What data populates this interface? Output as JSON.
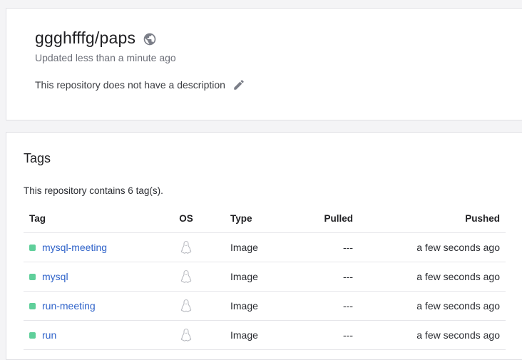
{
  "repo": {
    "name": "ggghfffg/paps",
    "updated": "Updated less than a minute ago",
    "description": "This repository does not have a description",
    "visibility_icon": "globe-icon",
    "edit_icon": "pencil-icon"
  },
  "tags": {
    "heading": "Tags",
    "count_text": "This repository contains 6 tag(s).",
    "columns": {
      "tag": "Tag",
      "os": "OS",
      "type": "Type",
      "pulled": "Pulled",
      "pushed": "Pushed"
    },
    "rows": [
      {
        "name": "mysql-meeting",
        "os_icon": "linux-icon",
        "type": "Image",
        "pulled": "---",
        "pushed": "a few seconds ago"
      },
      {
        "name": "mysql",
        "os_icon": "linux-icon",
        "type": "Image",
        "pulled": "---",
        "pushed": "a few seconds ago"
      },
      {
        "name": "run-meeting",
        "os_icon": "linux-icon",
        "type": "Image",
        "pulled": "---",
        "pushed": "a few seconds ago"
      },
      {
        "name": "run",
        "os_icon": "linux-icon",
        "type": "Image",
        "pulled": "---",
        "pushed": "a few seconds ago"
      }
    ]
  },
  "colors": {
    "tag_dot": "#5fcf9a",
    "link": "#2e62c9"
  }
}
